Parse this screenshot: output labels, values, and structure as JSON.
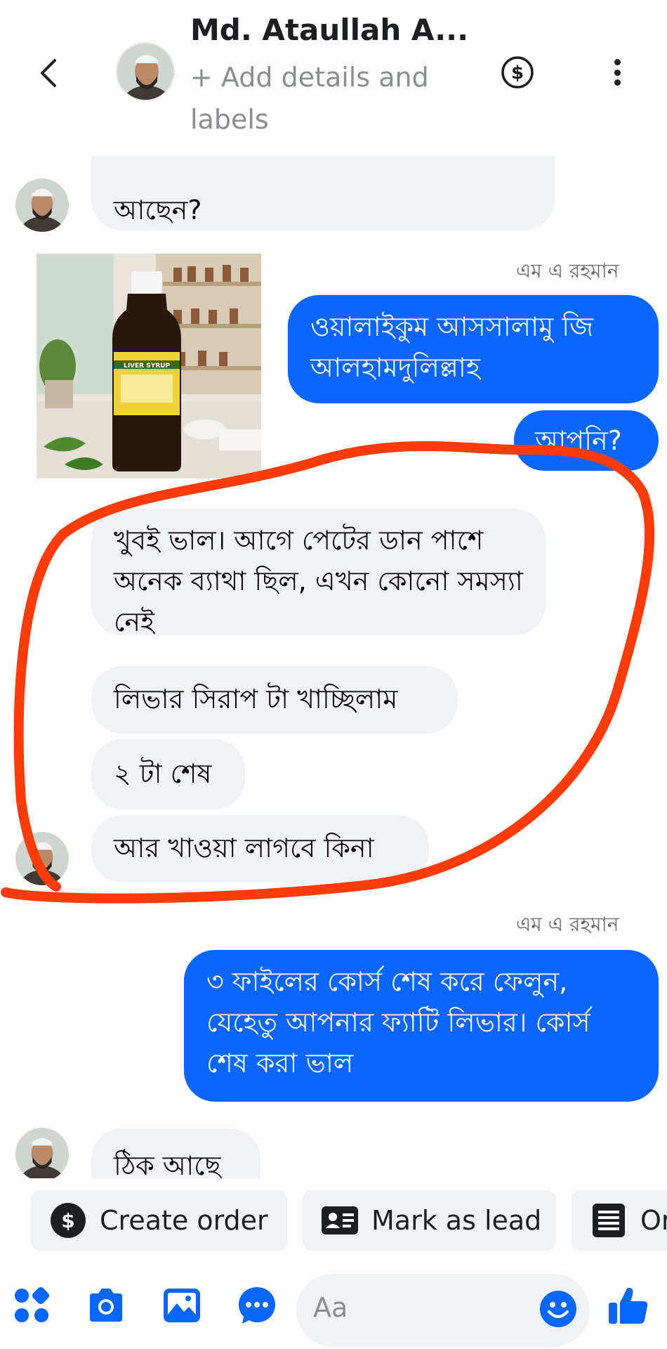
{
  "header": {
    "title": "Md. Ataullah A...",
    "subtitle": "+ Add details and labels"
  },
  "messages": {
    "top_partial": "আছেন?",
    "sender_1": "এম এ রহমান",
    "out_1": "ওয়ালাইকুম আসসালামু জি আলহামদুলিল্লাহ",
    "out_2": "আপনি?",
    "in_1": "খুবই ভাল। আগে পেটের ডান পাশে অনেক ব্যাথা ছিল, এখন কোনো সমস্যা নেই",
    "in_2": "লিভার সিরাপ টা খাচ্ছিলাম",
    "in_3": "২ টা শেষ",
    "in_4": "আর খাওয়া লাগবে কিনা",
    "sender_2": "এম এ রহমান",
    "out_3": "৩ ফাইলের কোর্স শেষ করে ফেলুন, যেহেতু আপনার ফ্যাটি লিভার। কোর্স শেষ করা ভাল",
    "in_5": "ঠিক আছে"
  },
  "product": {
    "label_title": "LIVER SYRUP"
  },
  "quick_actions": {
    "create_order": "Create order",
    "mark_as_lead": "Mark as lead",
    "third": "Or"
  },
  "composer": {
    "placeholder": "Aa"
  },
  "colors": {
    "outgoing_bubble": "#0a66ff",
    "incoming_bubble": "#f0f2f5",
    "accent_icon": "#0866ff",
    "annotation_stroke": "#ff3b0a"
  }
}
